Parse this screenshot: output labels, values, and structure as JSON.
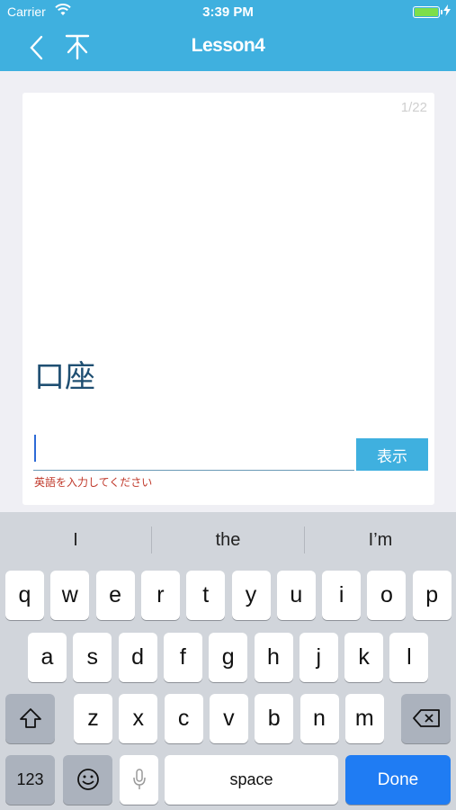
{
  "status": {
    "carrier": "Carrier",
    "time": "3:39 PM"
  },
  "nav": {
    "title": "Lesson4",
    "back_icon": "chevron-left-icon",
    "down_icon": "arrow-down-icon"
  },
  "card": {
    "counter": "1/22",
    "word": "口座",
    "input_value": "",
    "show_label": "表示",
    "hint": "英語を入力してください"
  },
  "keyboard": {
    "suggestions": [
      "I",
      "the",
      "I’m"
    ],
    "row1": [
      "q",
      "w",
      "e",
      "r",
      "t",
      "y",
      "u",
      "i",
      "o",
      "p"
    ],
    "row2": [
      "a",
      "s",
      "d",
      "f",
      "g",
      "h",
      "j",
      "k",
      "l"
    ],
    "row3": [
      "z",
      "x",
      "c",
      "v",
      "b",
      "n",
      "m"
    ],
    "numbers_label": "123",
    "space_label": "space",
    "done_label": "Done"
  },
  "colors": {
    "accent": "#3fb0df",
    "done": "#1f7cf3",
    "hint": "#c0392b",
    "word": "#1f4f72"
  }
}
